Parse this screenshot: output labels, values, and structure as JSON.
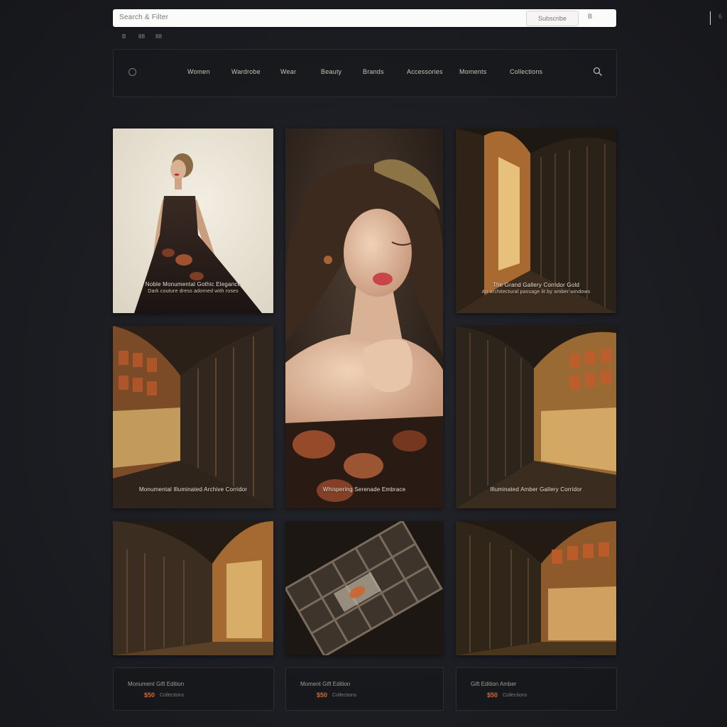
{
  "browser": {
    "url_text": "Search & Filter",
    "action_button": "Subscribe",
    "icon_a": "B",
    "icon_b": "6"
  },
  "toolbar": {
    "items": [
      "B",
      "88",
      "88"
    ]
  },
  "nav": {
    "items": [
      "Women",
      "Wardrobe",
      "Wear",
      "Beauty",
      "Brands",
      "Accessories",
      "Moments",
      "Collections"
    ]
  },
  "gallery": {
    "tile1": {
      "caption": "Noble Monumental Gothic Elegance",
      "subcaption": "Dark couture dress adorned with roses"
    },
    "tile3": {
      "caption": "The Grand Gallery Corridor Gold",
      "subcaption": "An architectural passage lit by amber windows"
    },
    "tile4": {
      "caption": "Monumental Illuminated Archive Corridor"
    },
    "tile5": {
      "caption": "Whispering Serenade Embrace"
    },
    "tile6": {
      "caption": "Illuminated Amber Gallery Corridor"
    }
  },
  "cards": [
    {
      "title": "Monument Gift Edition",
      "price": "$50",
      "meta": "Collections"
    },
    {
      "title": "Moment Gift Edition",
      "price": "$50",
      "meta": "Collections"
    },
    {
      "title": "Gift Edition Amber",
      "price": "$50",
      "meta": "Collections"
    }
  ],
  "colors": {
    "background": "#1c1d22",
    "accent": "#d2692f",
    "gold": "#c89a55"
  }
}
